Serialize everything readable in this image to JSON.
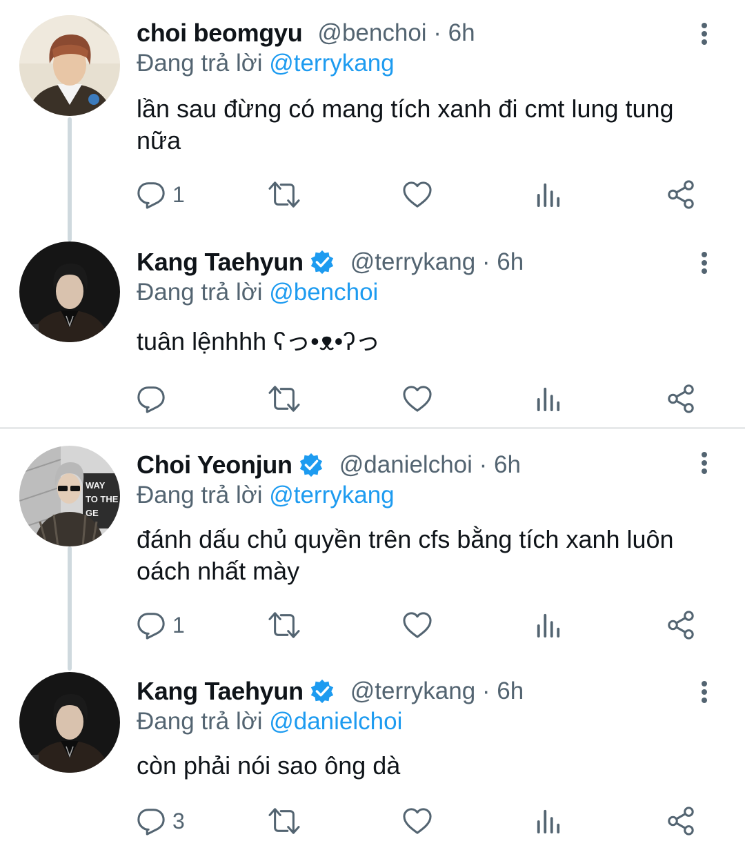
{
  "colors": {
    "accent": "#1d9bf0",
    "muted": "#536471",
    "text": "#0f1419",
    "thread_line": "#cfd9de",
    "separator": "#e7e9ea"
  },
  "tweets": [
    {
      "name": "choi beomgyu",
      "verified": false,
      "handle_meta": "@benchoi · 6h",
      "reply_prefix": "Đang trả lời",
      "reply_to": "@terrykang",
      "text": "lần sau đừng có mang tích xanh đi cmt lung tung nữa",
      "reply_count": "1",
      "avatar": "avatar-beomgyu"
    },
    {
      "name": "Kang Taehyun",
      "verified": true,
      "handle_meta": "@terrykang · 6h",
      "reply_prefix": "Đang trả lời",
      "reply_to": "@benchoi",
      "text": "tuân lệnhhh ʕっ•ᴥ•ʔっ",
      "reply_count": "",
      "avatar": "avatar-taehyun"
    },
    {
      "name": "Choi Yeonjun",
      "verified": true,
      "handle_meta": "@danielchoi · 6h",
      "reply_prefix": "Đang trả lời",
      "reply_to": "@terrykang",
      "text": "đánh dấu chủ quyền trên cfs bằng tích xanh luôn oách nhất mày",
      "reply_count": "1",
      "avatar": "avatar-yeonjun"
    },
    {
      "name": "Kang Taehyun",
      "verified": true,
      "handle_meta": "@terrykang · 6h",
      "reply_prefix": "Đang trả lời",
      "reply_to": "@danielchoi",
      "text": "còn phải nói sao ông dà",
      "reply_count": "3",
      "avatar": "avatar-taehyun"
    }
  ],
  "icons": [
    "more-vertical-icon",
    "reply-icon",
    "retweet-icon",
    "like-icon",
    "views-icon",
    "share-icon",
    "verified-badge-icon"
  ],
  "avatar_sign_text": "WAY TO THE GE"
}
